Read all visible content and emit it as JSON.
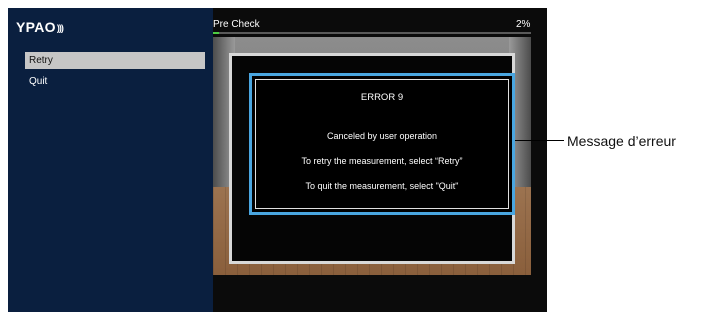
{
  "app": {
    "logo": "YPAO",
    "logo_waves": ")))"
  },
  "sidebar": {
    "items": [
      {
        "label": "Retry",
        "selected": true
      },
      {
        "label": "Quit",
        "selected": false
      }
    ]
  },
  "header": {
    "title": "Pre Check",
    "percent": "2%"
  },
  "progress": {
    "value": 0.02,
    "color": "#4ccb43"
  },
  "dialog": {
    "title": "ERROR 9",
    "line1": "Canceled by user operation",
    "line2": "To retry the measurement, select “Retry”",
    "line3": "To quit the measurement, select \"Quit\"",
    "frame_color": "#4aa6e0"
  },
  "annotation": {
    "label": "Message d’erreur"
  }
}
